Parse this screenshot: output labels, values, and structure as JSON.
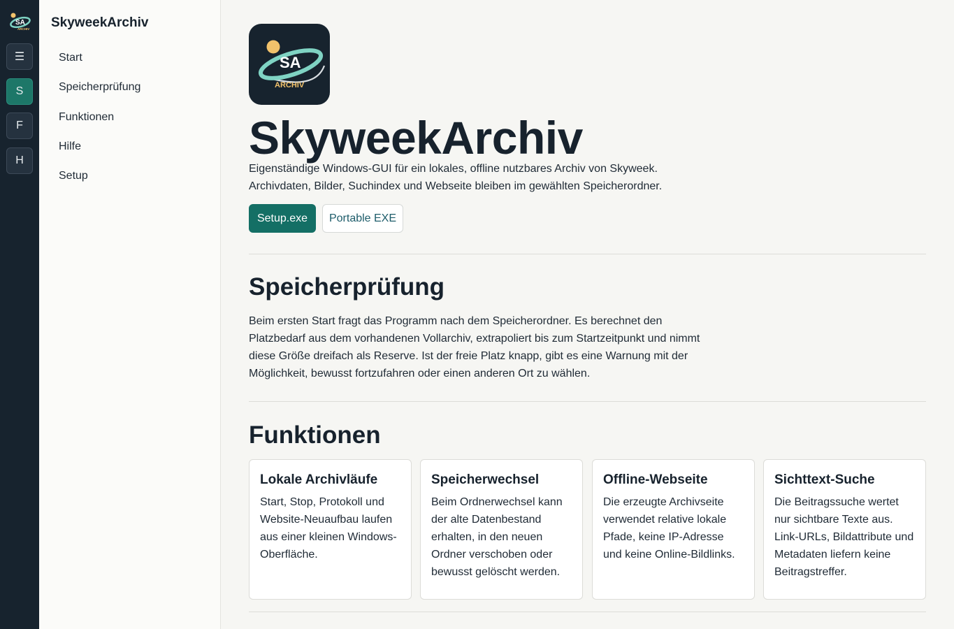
{
  "rail": {
    "logo_text": "SA",
    "logo_subtext": "ARCHIV",
    "buttons": [
      {
        "label": "☰",
        "icon": "menu-icon",
        "active": false
      },
      {
        "label": "S",
        "active": true
      },
      {
        "label": "F",
        "active": false
      },
      {
        "label": "H",
        "active": false
      }
    ]
  },
  "sidebar": {
    "title": "SkyweekArchiv",
    "items": [
      {
        "label": "Start"
      },
      {
        "label": "Speicherprüfung"
      },
      {
        "label": "Funktionen"
      },
      {
        "label": "Hilfe"
      },
      {
        "label": "Setup"
      }
    ]
  },
  "hero": {
    "logo_text": "SA",
    "logo_subtext": "ARCHIV",
    "title": "SkyweekArchiv",
    "line1": "Eigenständige Windows-GUI für ein lokales, offline nutzbares Archiv von Skyweek.",
    "line2": "Archivdaten, Bilder, Suchindex und Webseite bleiben im gewählten Speicherordner.",
    "primary_button": "Setup.exe",
    "secondary_button": "Portable EXE"
  },
  "storage": {
    "heading": "Speicherprüfung",
    "text": "Beim ersten Start fragt das Programm nach dem Speicherordner. Es berechnet den Platzbedarf aus dem vorhandenen Vollarchiv, extrapoliert bis zum Startzeitpunkt und nimmt diese Größe dreifach als Reserve. Ist der freie Platz knapp, gibt es eine Warnung mit der Möglichkeit, bewusst fortzufahren oder einen anderen Ort zu wählen."
  },
  "features": {
    "heading": "Funktionen",
    "cards": [
      {
        "title": "Lokale Archivläufe",
        "text": "Start, Stop, Protokoll und Website-Neuaufbau laufen aus einer kleinen Windows-Oberfläche."
      },
      {
        "title": "Speicherwechsel",
        "text": "Beim Ordnerwechsel kann der alte Datenbestand erhalten, in den neuen Ordner verschoben oder bewusst gelöscht werden."
      },
      {
        "title": "Offline-Webseite",
        "text": "Die erzeugte Archivseite verwendet relative lokale Pfade, keine IP-Adresse und keine Online-Bildlinks."
      },
      {
        "title": "Sichttext-Suche",
        "text": "Die Beitragssuche wertet nur sichtbare Texte aus. Link-URLs, Bildattribute und Metadaten liefern keine Beitragstreffer."
      }
    ]
  },
  "colors": {
    "rail_bg": "#17232e",
    "accent": "#146f65",
    "logo_teal": "#7fd3c3",
    "logo_sun": "#f2c26b"
  }
}
